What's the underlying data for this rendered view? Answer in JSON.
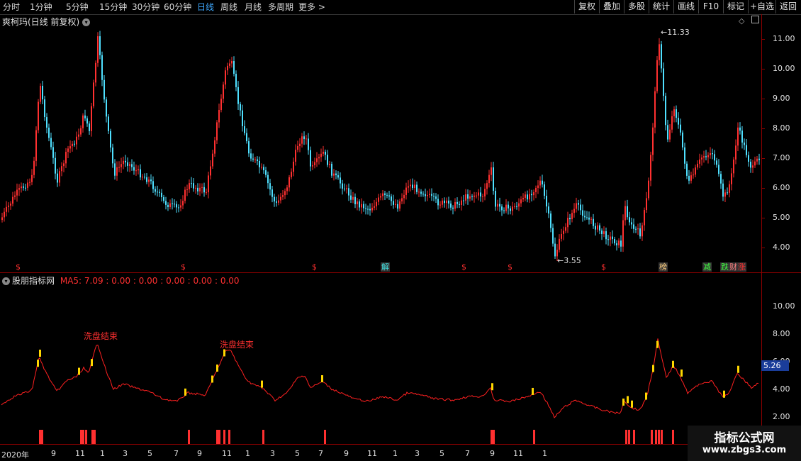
{
  "toolbar": {
    "period_tabs": [
      "分时",
      "1分钟",
      "5分钟",
      "15分钟",
      "30分钟",
      "60分钟",
      "日线",
      "周线",
      "月线",
      "多周期",
      "更多 >"
    ],
    "active_tab": "日线",
    "right_buttons": [
      "复权",
      "叠加",
      "多股",
      "统计",
      "画线",
      "F10",
      "标记",
      "+自选",
      "返回"
    ]
  },
  "main_panel": {
    "title": "爽柯玛(日线 前复权)",
    "y_ticks": [
      "11.00",
      "10.00",
      "9.00",
      "8.00",
      "7.00",
      "6.00",
      "5.00",
      "4.00"
    ],
    "high_label": "11.33",
    "low_label": "3.55",
    "events": [
      {
        "text": "$",
        "color": "#ff3030"
      },
      {
        "text": "$",
        "color": "#ff3030"
      },
      {
        "text": "$",
        "color": "#ff3030"
      },
      {
        "text": "解",
        "color": "#40e0e0"
      },
      {
        "text": "$",
        "color": "#ff3030"
      },
      {
        "text": "$",
        "color": "#ff3030"
      },
      {
        "text": "$",
        "color": "#ff3030"
      },
      {
        "text": "榜",
        "color": "#ffd080"
      },
      {
        "text": "减",
        "color": "#40ff40"
      },
      {
        "text": "跌",
        "color": "#40ff40"
      },
      {
        "text": "财",
        "color": "#ff8080"
      },
      {
        "text": "涨",
        "color": "#ff3030"
      }
    ]
  },
  "indicator_panel": {
    "title": "股朋指标网",
    "ma_text": "MA5: 7.09 : 0.00 : 0.00 : 0.00 : 0.00 : 0.00",
    "y_ticks": [
      "10.00",
      "8.00",
      "6.00",
      "4.00",
      "2.00"
    ],
    "current_value": "5.26",
    "annotations": [
      "洗盘结束",
      "洗盘结束"
    ]
  },
  "x_axis": {
    "ticks": [
      "2020年",
      "9",
      "11",
      "1",
      "3",
      "5",
      "7",
      "9",
      "11",
      "1",
      "3",
      "5",
      "7",
      "9",
      "11",
      "1",
      "3",
      "5",
      "7",
      "9",
      "11",
      "1"
    ]
  },
  "watermark": {
    "line1": "指标公式网",
    "line2": "www.zbgs3.com"
  },
  "colors": {
    "up": "#ff3030",
    "down": "#4fe0ff",
    "ma_line": "#ff2020",
    "signal": "#ffd700",
    "axis_red": "#8b0000"
  }
}
